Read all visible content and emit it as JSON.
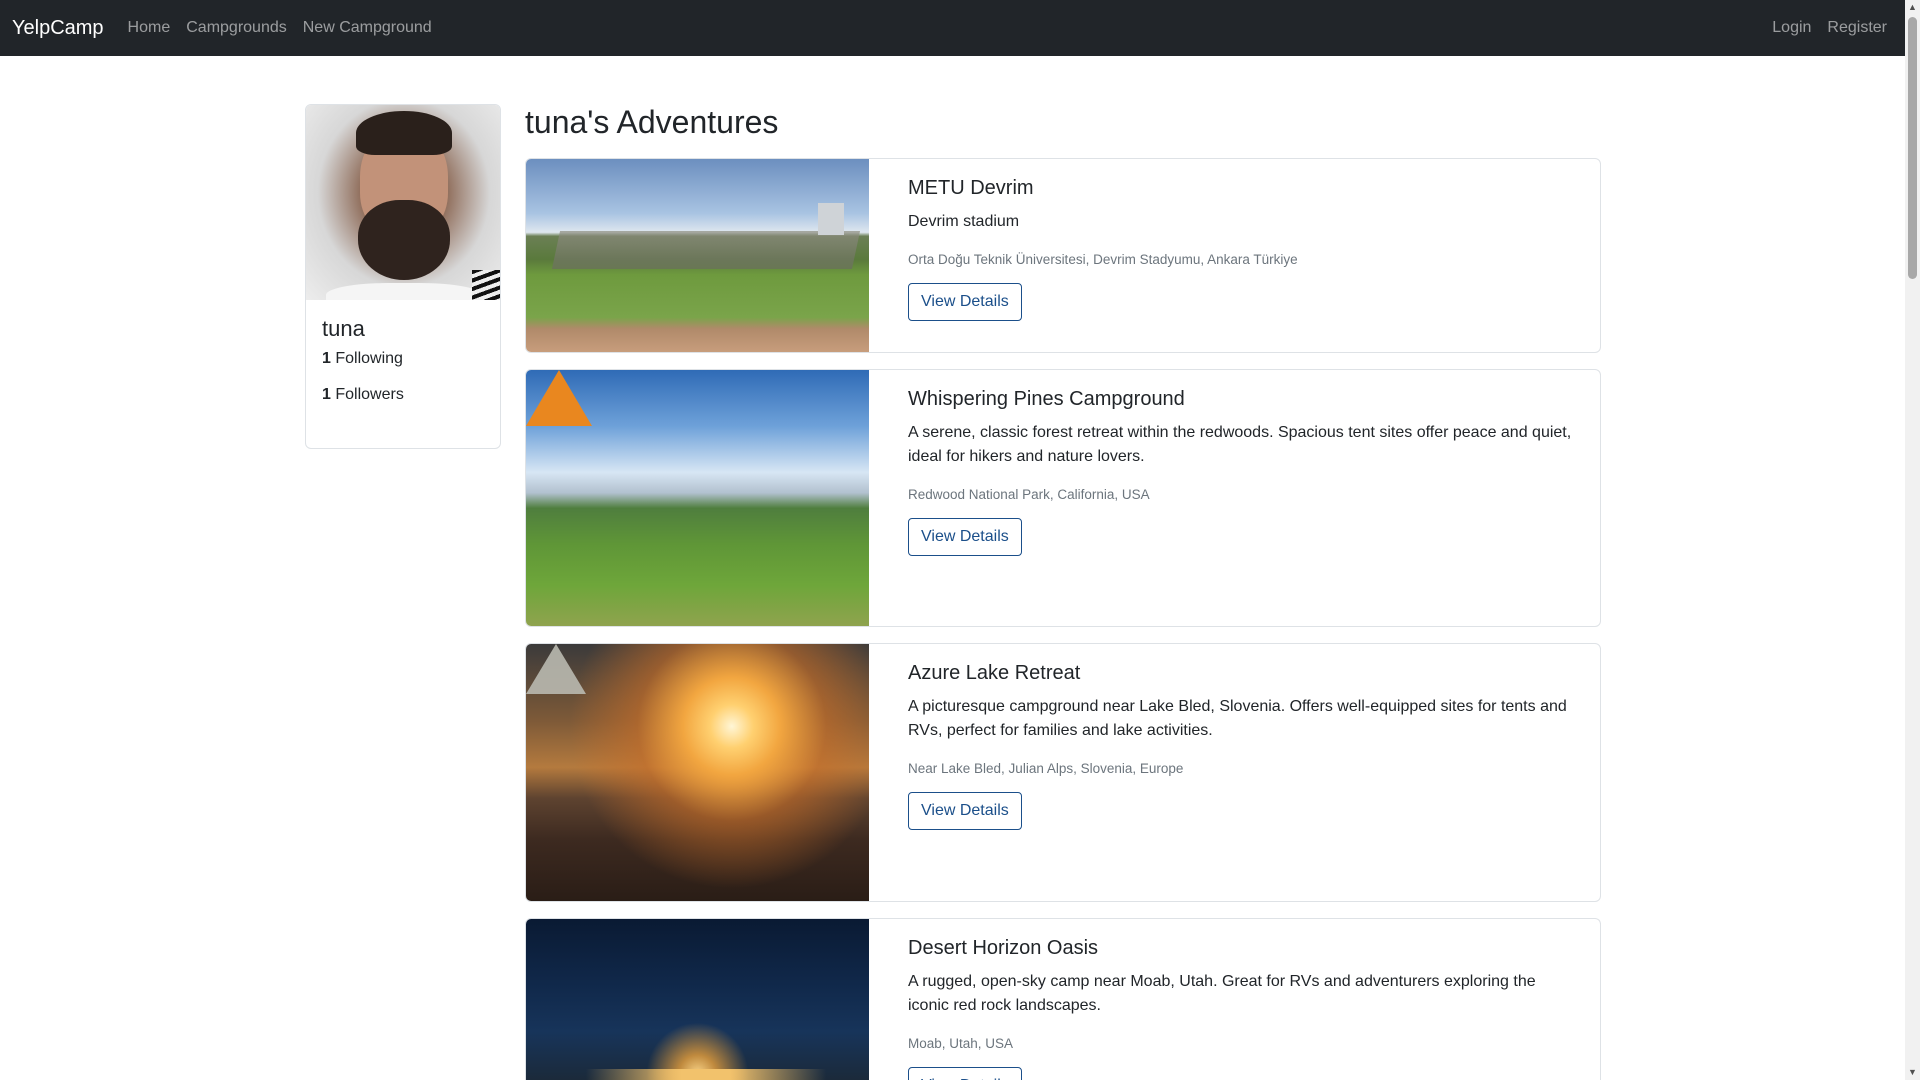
{
  "navbar": {
    "brand": "YelpCamp",
    "links": [
      "Home",
      "Campgrounds",
      "New Campground"
    ],
    "right_links": [
      "Login",
      "Register"
    ]
  },
  "profile": {
    "name": "tuna",
    "following_count": "1",
    "following_label": "Following",
    "followers_count": "1",
    "followers_label": "Followers"
  },
  "page": {
    "title": "tuna's Adventures"
  },
  "campgrounds": [
    {
      "title": "METU Devrim",
      "description": "Devrim stadium",
      "location": "Orta Doğu Teknik Üniversitesi, Devrim Stadyumu, Ankara Türkiye",
      "button": "View Details"
    },
    {
      "title": "Whispering Pines Campground",
      "description": "A serene, classic forest retreat within the redwoods. Spacious tent sites offer peace and quiet, ideal for hikers and nature lovers.",
      "location": "Redwood National Park, California, USA",
      "button": "View Details"
    },
    {
      "title": "Azure Lake Retreat",
      "description": "A picturesque campground near Lake Bled, Slovenia. Offers well-equipped sites for tents and RVs, perfect for families and lake activities.",
      "location": "Near Lake Bled, Julian Alps, Slovenia, Europe",
      "button": "View Details"
    },
    {
      "title": "Desert Horizon Oasis",
      "description": "A rugged, open-sky camp near Moab, Utah. Great for RVs and adventurers exploring the iconic red rock landscapes.",
      "location": "Moab, Utah, USA",
      "button": "View Details"
    }
  ],
  "colors": {
    "navbar_bg": "#212529",
    "button_outline": "#1b4f8a",
    "muted_text": "#6c757d"
  }
}
